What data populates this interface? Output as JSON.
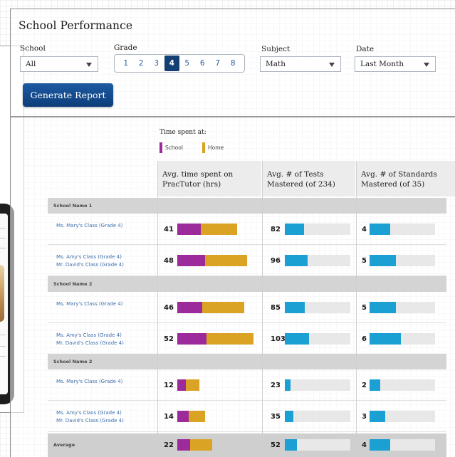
{
  "page": {
    "title": "School Performance"
  },
  "filters": {
    "school": {
      "label": "School",
      "value": "All"
    },
    "grade": {
      "label": "Grade",
      "options": [
        "1",
        "2",
        "3",
        "4",
        "5",
        "6",
        "7",
        "8"
      ],
      "selected": "4"
    },
    "subject": {
      "label": "Subject",
      "value": "Math"
    },
    "date": {
      "label": "Date",
      "value": "Last Month"
    }
  },
  "generate_button": "Generate Report",
  "legend": {
    "title": "Time spent at:",
    "school": {
      "label": "School",
      "color": "#9c2a9a"
    },
    "home": {
      "label": "Home",
      "color": "#dba323"
    }
  },
  "columns": {
    "time": [
      "Avg. time spent on",
      "PracTutor (hrs)"
    ],
    "tests": [
      "Avg. # of Tests",
      "Mastered (of 234)"
    ],
    "standards": [
      "Avg. # of Standards",
      "Mastered (of 35)"
    ]
  },
  "groups": [
    {
      "name": "School Name 1",
      "rows": [
        {
          "classes": [
            "Ms. Mary's Class (Grade 4)"
          ],
          "time": 41,
          "school_hrs": 16,
          "home_hrs": 25,
          "tests": 82,
          "standards": 4
        },
        {
          "classes": [
            "Ms. Amy's Class (Grade 4)",
            "Mr. David's Class (Grade 4)"
          ],
          "time": 48,
          "school_hrs": 19,
          "home_hrs": 29,
          "tests": 96,
          "standards": 5
        }
      ]
    },
    {
      "name": "School Name 2",
      "rows": [
        {
          "classes": [
            "Ms. Mary's Class (Grade 4)"
          ],
          "time": 46,
          "school_hrs": 17,
          "home_hrs": 29,
          "tests": 85,
          "standards": 5
        },
        {
          "classes": [
            "Ms. Amy's Class (Grade 4)",
            "Mr. David's Class (Grade 4)"
          ],
          "time": 52,
          "school_hrs": 20,
          "home_hrs": 32,
          "tests": 103,
          "standards": 6
        }
      ]
    },
    {
      "name": "School Name 2",
      "rows": [
        {
          "classes": [
            "Ms. Mary's Class (Grade 4)"
          ],
          "time": 12,
          "school_hrs": 6,
          "home_hrs": 9,
          "tests": 23,
          "standards": 2
        },
        {
          "classes": [
            "Ms. Amy's Class (Grade 4)",
            "Mr. David's Class (Grade 4)"
          ],
          "time": 14,
          "school_hrs": 8,
          "home_hrs": 11,
          "tests": 35,
          "standards": 3
        }
      ]
    }
  ],
  "average": {
    "label": "Average",
    "time": 22,
    "school_hrs": 9,
    "home_hrs": 15,
    "tests": 52,
    "standards": 4
  },
  "colors": {
    "bar_blue": "#1aa0d2",
    "accent_navy": "#143f74"
  }
}
